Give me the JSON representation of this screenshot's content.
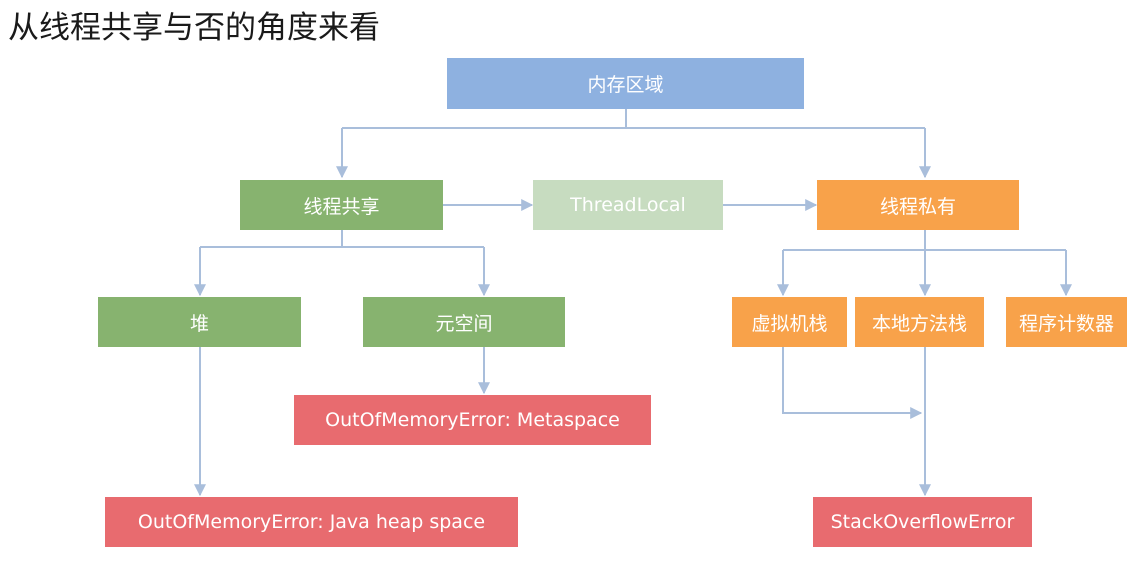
{
  "heading": "从线程共享与否的角度来看",
  "colors": {
    "memory": "#8eb1e0",
    "shared": "#87b36f",
    "threadlocal": "#c7dcc0",
    "private": "#f8a24a",
    "error": "#e86b6f",
    "connector": "#a9bedb"
  },
  "nodes": {
    "memory_area": "内存区域",
    "thread_shared": "线程共享",
    "thread_local": "ThreadLocal",
    "thread_private": "线程私有",
    "heap": "堆",
    "metaspace": "元空间",
    "vm_stack": "虚拟机栈",
    "native_method_stack": "本地方法栈",
    "program_counter": "程序计数器",
    "oom_metaspace": "OutOfMemoryError: Metaspace",
    "oom_heap": "OutOfMemoryError: Java heap space",
    "stack_overflow": "StackOverflowError"
  }
}
